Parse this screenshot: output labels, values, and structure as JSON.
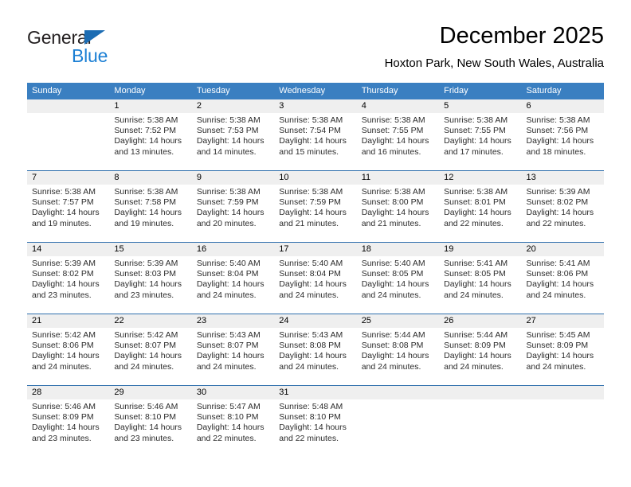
{
  "logo": {
    "word_top": "General",
    "word_bottom": "Blue",
    "triangle_color": "#1b6cb3",
    "blue_color": "#1b7fd4"
  },
  "header": {
    "month_title": "December 2025",
    "location": "Hoxton Park, New South Wales, Australia"
  },
  "theme": {
    "header_bar_color": "#3a7fc1",
    "row_divider_color": "#2f6fad",
    "day_band_color": "#efefef",
    "text_color": "#2b2b2b"
  },
  "weekdays": [
    "Sunday",
    "Monday",
    "Tuesday",
    "Wednesday",
    "Thursday",
    "Friday",
    "Saturday"
  ],
  "labels": {
    "sunrise_prefix": "Sunrise:",
    "sunset_prefix": "Sunset:",
    "daylight_prefix": "Daylight:"
  },
  "weeks": [
    [
      {
        "day": "",
        "sunrise": "",
        "sunset": "",
        "daylight_a": "",
        "daylight_b": ""
      },
      {
        "day": "1",
        "sunrise": "Sunrise: 5:38 AM",
        "sunset": "Sunset: 7:52 PM",
        "daylight_a": "Daylight: 14 hours",
        "daylight_b": "and 13 minutes."
      },
      {
        "day": "2",
        "sunrise": "Sunrise: 5:38 AM",
        "sunset": "Sunset: 7:53 PM",
        "daylight_a": "Daylight: 14 hours",
        "daylight_b": "and 14 minutes."
      },
      {
        "day": "3",
        "sunrise": "Sunrise: 5:38 AM",
        "sunset": "Sunset: 7:54 PM",
        "daylight_a": "Daylight: 14 hours",
        "daylight_b": "and 15 minutes."
      },
      {
        "day": "4",
        "sunrise": "Sunrise: 5:38 AM",
        "sunset": "Sunset: 7:55 PM",
        "daylight_a": "Daylight: 14 hours",
        "daylight_b": "and 16 minutes."
      },
      {
        "day": "5",
        "sunrise": "Sunrise: 5:38 AM",
        "sunset": "Sunset: 7:55 PM",
        "daylight_a": "Daylight: 14 hours",
        "daylight_b": "and 17 minutes."
      },
      {
        "day": "6",
        "sunrise": "Sunrise: 5:38 AM",
        "sunset": "Sunset: 7:56 PM",
        "daylight_a": "Daylight: 14 hours",
        "daylight_b": "and 18 minutes."
      }
    ],
    [
      {
        "day": "7",
        "sunrise": "Sunrise: 5:38 AM",
        "sunset": "Sunset: 7:57 PM",
        "daylight_a": "Daylight: 14 hours",
        "daylight_b": "and 19 minutes."
      },
      {
        "day": "8",
        "sunrise": "Sunrise: 5:38 AM",
        "sunset": "Sunset: 7:58 PM",
        "daylight_a": "Daylight: 14 hours",
        "daylight_b": "and 19 minutes."
      },
      {
        "day": "9",
        "sunrise": "Sunrise: 5:38 AM",
        "sunset": "Sunset: 7:59 PM",
        "daylight_a": "Daylight: 14 hours",
        "daylight_b": "and 20 minutes."
      },
      {
        "day": "10",
        "sunrise": "Sunrise: 5:38 AM",
        "sunset": "Sunset: 7:59 PM",
        "daylight_a": "Daylight: 14 hours",
        "daylight_b": "and 21 minutes."
      },
      {
        "day": "11",
        "sunrise": "Sunrise: 5:38 AM",
        "sunset": "Sunset: 8:00 PM",
        "daylight_a": "Daylight: 14 hours",
        "daylight_b": "and 21 minutes."
      },
      {
        "day": "12",
        "sunrise": "Sunrise: 5:38 AM",
        "sunset": "Sunset: 8:01 PM",
        "daylight_a": "Daylight: 14 hours",
        "daylight_b": "and 22 minutes."
      },
      {
        "day": "13",
        "sunrise": "Sunrise: 5:39 AM",
        "sunset": "Sunset: 8:02 PM",
        "daylight_a": "Daylight: 14 hours",
        "daylight_b": "and 22 minutes."
      }
    ],
    [
      {
        "day": "14",
        "sunrise": "Sunrise: 5:39 AM",
        "sunset": "Sunset: 8:02 PM",
        "daylight_a": "Daylight: 14 hours",
        "daylight_b": "and 23 minutes."
      },
      {
        "day": "15",
        "sunrise": "Sunrise: 5:39 AM",
        "sunset": "Sunset: 8:03 PM",
        "daylight_a": "Daylight: 14 hours",
        "daylight_b": "and 23 minutes."
      },
      {
        "day": "16",
        "sunrise": "Sunrise: 5:40 AM",
        "sunset": "Sunset: 8:04 PM",
        "daylight_a": "Daylight: 14 hours",
        "daylight_b": "and 24 minutes."
      },
      {
        "day": "17",
        "sunrise": "Sunrise: 5:40 AM",
        "sunset": "Sunset: 8:04 PM",
        "daylight_a": "Daylight: 14 hours",
        "daylight_b": "and 24 minutes."
      },
      {
        "day": "18",
        "sunrise": "Sunrise: 5:40 AM",
        "sunset": "Sunset: 8:05 PM",
        "daylight_a": "Daylight: 14 hours",
        "daylight_b": "and 24 minutes."
      },
      {
        "day": "19",
        "sunrise": "Sunrise: 5:41 AM",
        "sunset": "Sunset: 8:05 PM",
        "daylight_a": "Daylight: 14 hours",
        "daylight_b": "and 24 minutes."
      },
      {
        "day": "20",
        "sunrise": "Sunrise: 5:41 AM",
        "sunset": "Sunset: 8:06 PM",
        "daylight_a": "Daylight: 14 hours",
        "daylight_b": "and 24 minutes."
      }
    ],
    [
      {
        "day": "21",
        "sunrise": "Sunrise: 5:42 AM",
        "sunset": "Sunset: 8:06 PM",
        "daylight_a": "Daylight: 14 hours",
        "daylight_b": "and 24 minutes."
      },
      {
        "day": "22",
        "sunrise": "Sunrise: 5:42 AM",
        "sunset": "Sunset: 8:07 PM",
        "daylight_a": "Daylight: 14 hours",
        "daylight_b": "and 24 minutes."
      },
      {
        "day": "23",
        "sunrise": "Sunrise: 5:43 AM",
        "sunset": "Sunset: 8:07 PM",
        "daylight_a": "Daylight: 14 hours",
        "daylight_b": "and 24 minutes."
      },
      {
        "day": "24",
        "sunrise": "Sunrise: 5:43 AM",
        "sunset": "Sunset: 8:08 PM",
        "daylight_a": "Daylight: 14 hours",
        "daylight_b": "and 24 minutes."
      },
      {
        "day": "25",
        "sunrise": "Sunrise: 5:44 AM",
        "sunset": "Sunset: 8:08 PM",
        "daylight_a": "Daylight: 14 hours",
        "daylight_b": "and 24 minutes."
      },
      {
        "day": "26",
        "sunrise": "Sunrise: 5:44 AM",
        "sunset": "Sunset: 8:09 PM",
        "daylight_a": "Daylight: 14 hours",
        "daylight_b": "and 24 minutes."
      },
      {
        "day": "27",
        "sunrise": "Sunrise: 5:45 AM",
        "sunset": "Sunset: 8:09 PM",
        "daylight_a": "Daylight: 14 hours",
        "daylight_b": "and 24 minutes."
      }
    ],
    [
      {
        "day": "28",
        "sunrise": "Sunrise: 5:46 AM",
        "sunset": "Sunset: 8:09 PM",
        "daylight_a": "Daylight: 14 hours",
        "daylight_b": "and 23 minutes."
      },
      {
        "day": "29",
        "sunrise": "Sunrise: 5:46 AM",
        "sunset": "Sunset: 8:10 PM",
        "daylight_a": "Daylight: 14 hours",
        "daylight_b": "and 23 minutes."
      },
      {
        "day": "30",
        "sunrise": "Sunrise: 5:47 AM",
        "sunset": "Sunset: 8:10 PM",
        "daylight_a": "Daylight: 14 hours",
        "daylight_b": "and 22 minutes."
      },
      {
        "day": "31",
        "sunrise": "Sunrise: 5:48 AM",
        "sunset": "Sunset: 8:10 PM",
        "daylight_a": "Daylight: 14 hours",
        "daylight_b": "and 22 minutes."
      },
      {
        "day": "",
        "sunrise": "",
        "sunset": "",
        "daylight_a": "",
        "daylight_b": ""
      },
      {
        "day": "",
        "sunrise": "",
        "sunset": "",
        "daylight_a": "",
        "daylight_b": ""
      },
      {
        "day": "",
        "sunrise": "",
        "sunset": "",
        "daylight_a": "",
        "daylight_b": ""
      }
    ]
  ]
}
